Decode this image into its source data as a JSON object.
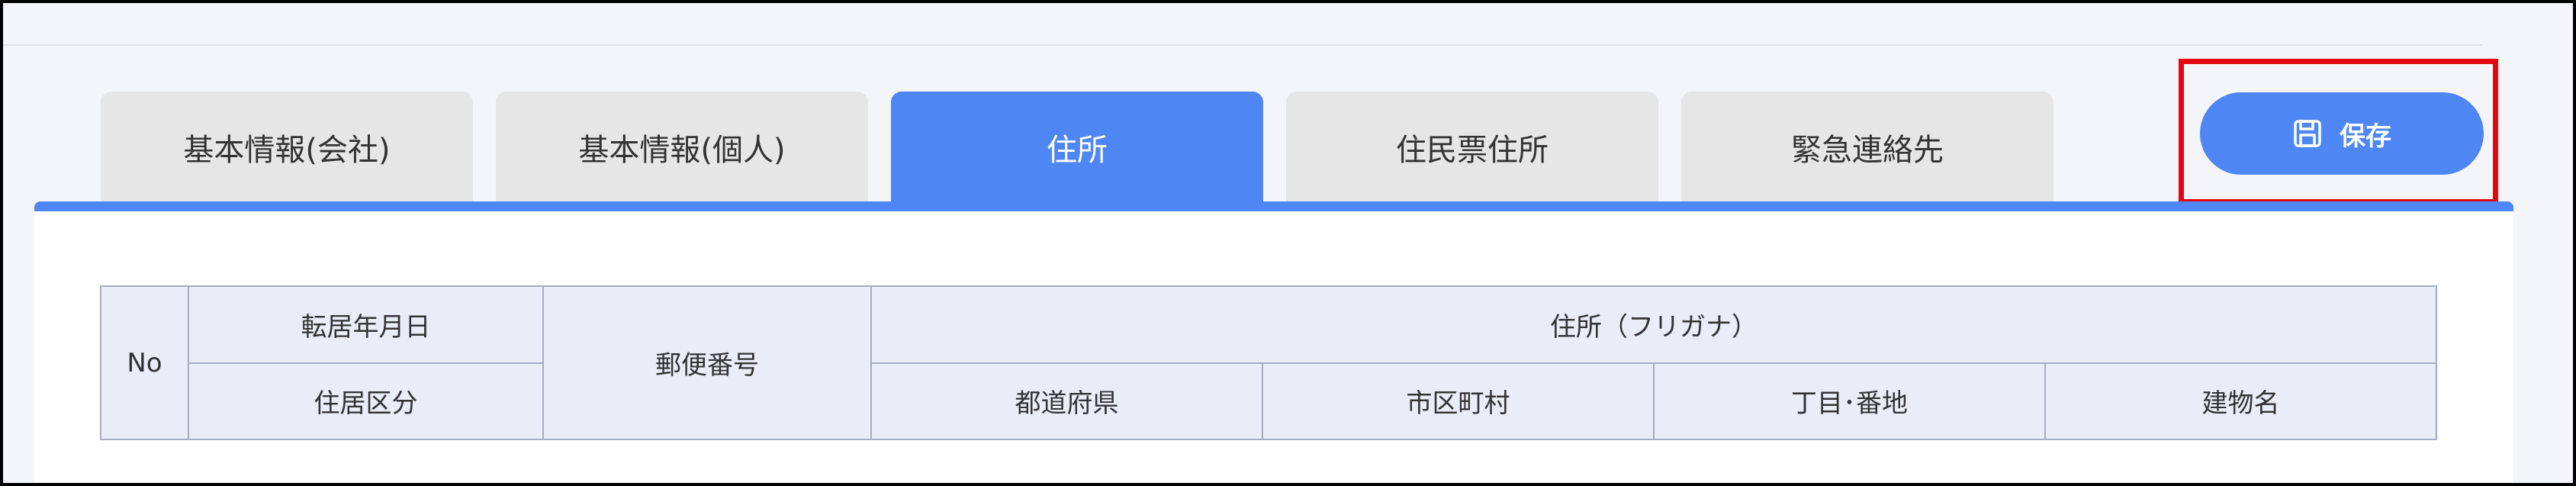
{
  "tabs": [
    {
      "label": "基本情報(会社)",
      "active": false
    },
    {
      "label": "基本情報(個人)",
      "active": false
    },
    {
      "label": "住所",
      "active": true
    },
    {
      "label": "住民票住所",
      "active": false
    },
    {
      "label": "緊急連絡先",
      "active": false
    }
  ],
  "toolbar": {
    "save_label": "保存",
    "save_icon": "floppy-disk-icon"
  },
  "table": {
    "headers": {
      "no": "No",
      "move_date": "転居年月日",
      "residence_type": "住居区分",
      "postal_code": "郵便番号",
      "address_group": "住所（フリガナ）",
      "prefecture": "都道府県",
      "city": "市区町村",
      "block": "丁目･番地",
      "building": "建物名"
    }
  },
  "colors": {
    "accent": "#4e86f3",
    "highlight": "#e30613",
    "header_bg": "#e8edf8",
    "tab_inactive": "#e6e6e6"
  }
}
